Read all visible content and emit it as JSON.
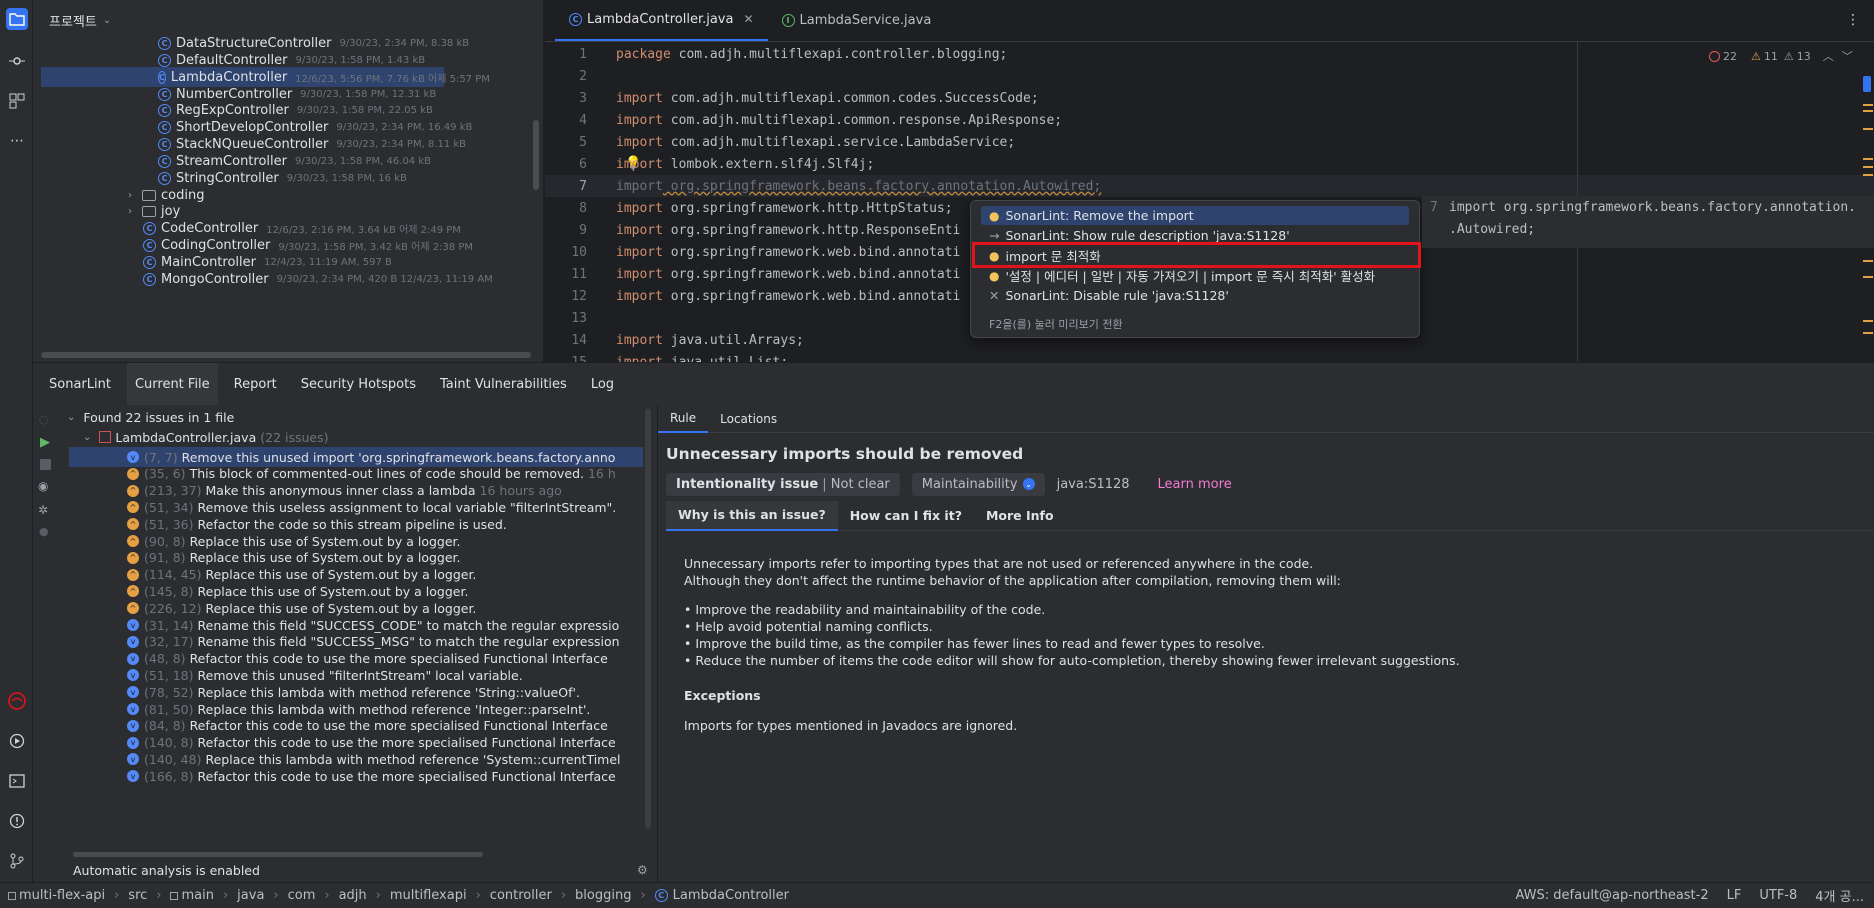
{
  "project": {
    "title": "프로젝트",
    "items": [
      {
        "name": "DataStructureController",
        "meta": "9/30/23, 2:34 PM, 8.38 kB",
        "type": "class"
      },
      {
        "name": "DefaultController",
        "meta": "9/30/23, 1:58 PM, 1.43 kB",
        "type": "class"
      },
      {
        "name": "LambdaController",
        "meta": "12/6/23, 5:56 PM, 7.76 kB 어제 5:57 PM",
        "type": "class",
        "selected": true
      },
      {
        "name": "NumberController",
        "meta": "9/30/23, 1:58 PM, 12.31 kB",
        "type": "class"
      },
      {
        "name": "RegExpController",
        "meta": "9/30/23, 1:58 PM, 22.05 kB",
        "type": "class"
      },
      {
        "name": "ShortDevelopController",
        "meta": "9/30/23, 2:34 PM, 16.49 kB",
        "type": "class"
      },
      {
        "name": "StackNQueueController",
        "meta": "9/30/23, 2:34 PM, 8.11 kB",
        "type": "class"
      },
      {
        "name": "StreamController",
        "meta": "9/30/23, 1:58 PM, 46.04 kB",
        "type": "class"
      },
      {
        "name": "StringController",
        "meta": "9/30/23, 1:58 PM, 16 kB",
        "type": "class"
      },
      {
        "name": "coding",
        "meta": "",
        "type": "folder"
      },
      {
        "name": "joy",
        "meta": "",
        "type": "folder"
      },
      {
        "name": "CodeController",
        "meta": "12/6/23, 2:16 PM, 3.64 kB 어제 2:49 PM",
        "type": "class"
      },
      {
        "name": "CodingController",
        "meta": "9/30/23, 1:58 PM, 3.42 kB 어제 2:38 PM",
        "type": "class"
      },
      {
        "name": "MainController",
        "meta": "12/4/23, 11:19 AM, 597 B",
        "type": "class"
      },
      {
        "name": "MongoController",
        "meta": "9/30/23, 2:34 PM, 420 B 12/4/23, 11:19 AM",
        "type": "class"
      }
    ]
  },
  "editor": {
    "tabs": [
      {
        "label": "LambdaController.java",
        "active": true
      },
      {
        "label": "LambdaService.java",
        "active": false
      }
    ],
    "inspections": {
      "errors": "22",
      "warnings": "11",
      "weak": "13"
    },
    "lines": [
      {
        "n": "1",
        "kw": "package",
        "rest": " com.adjh.multiflexapi.controller.blogging;"
      },
      {
        "n": "2",
        "kw": "",
        "rest": ""
      },
      {
        "n": "3",
        "kw": "import",
        "rest": " com.adjh.multiflexapi.common.codes.SuccessCode;"
      },
      {
        "n": "4",
        "kw": "import",
        "rest": " com.adjh.multiflexapi.common.response.ApiResponse;"
      },
      {
        "n": "5",
        "kw": "import",
        "rest": " com.adjh.multiflexapi.service.LambdaService;"
      },
      {
        "n": "6",
        "kw": "import",
        "rest": " lombok.extern.slf4j.Slf4j;"
      },
      {
        "n": "7",
        "kw": "import",
        "rest": " org.springframework.beans.factory.annotation.Autowired;"
      },
      {
        "n": "8",
        "kw": "import",
        "rest": " org.springframework.http.HttpStatus;"
      },
      {
        "n": "9",
        "kw": "import",
        "rest": " org.springframework.http.ResponseEnti"
      },
      {
        "n": "10",
        "kw": "import",
        "rest": " org.springframework.web.bind.annotati"
      },
      {
        "n": "11",
        "kw": "import",
        "rest": " org.springframework.web.bind.annotati"
      },
      {
        "n": "12",
        "kw": "import",
        "rest": " org.springframework.web.bind.annotati"
      },
      {
        "n": "13",
        "kw": "",
        "rest": ""
      },
      {
        "n": "14",
        "kw": "import",
        "rest": " java.util.Arrays;"
      },
      {
        "n": "15",
        "kw": "import",
        "rest": " java.util.List;"
      }
    ]
  },
  "popup": {
    "items": [
      {
        "label": "SonarLint: Remove the import",
        "icon": "bulb",
        "selected": true
      },
      {
        "label": "SonarLint: Show rule description 'java:S1128'",
        "icon": "arrow"
      },
      {
        "label": "import 문 최적화",
        "icon": "bulb"
      },
      {
        "label": "'설정 | 에디터 | 일반 | 자동 가져오기 | import 문 즉시 최적화' 활성화",
        "icon": "bulb"
      },
      {
        "label": "SonarLint: Disable rule 'java:S1128'",
        "icon": "x"
      }
    ],
    "footer": "F2을(를) 눌러 미리보기 전환",
    "preview_line_num": "7",
    "preview_line1": "import org.springframework.beans.factory.annotation.",
    "preview_line2": ".Autowired;"
  },
  "bottom": {
    "tabs": [
      "SonarLint",
      "Current File",
      "Report",
      "Security Hotspots",
      "Taint Vulnerabilities",
      "Log"
    ],
    "found": "Found 22 issues in 1 file",
    "file": "LambdaController.java",
    "file_count": "(22 issues)",
    "issues": [
      {
        "loc": "(7, 7)",
        "msg": "Remove this unused import 'org.springframework.beans.factory.anno",
        "sev": "minor",
        "selected": true
      },
      {
        "loc": "(35, 6)",
        "msg": "This block of commented-out lines of code should be removed.",
        "extra": "16 h",
        "sev": "major"
      },
      {
        "loc": "(213, 37)",
        "msg": "Make this anonymous inner class a lambda",
        "extra": "16 hours ago",
        "sev": "major"
      },
      {
        "loc": "(51, 34)",
        "msg": "Remove this useless assignment to local variable \"filterIntStream\".",
        "sev": "major"
      },
      {
        "loc": "(51, 36)",
        "msg": "Refactor the code so this stream pipeline is used.",
        "sev": "major"
      },
      {
        "loc": "(90, 8)",
        "msg": "Replace this use of System.out by a logger.",
        "sev": "major"
      },
      {
        "loc": "(91, 8)",
        "msg": "Replace this use of System.out by a logger.",
        "sev": "major"
      },
      {
        "loc": "(114, 45)",
        "msg": "Replace this use of System.out by a logger.",
        "sev": "major"
      },
      {
        "loc": "(145, 8)",
        "msg": "Replace this use of System.out by a logger.",
        "sev": "major"
      },
      {
        "loc": "(226, 12)",
        "msg": "Replace this use of System.out by a logger.",
        "sev": "major"
      },
      {
        "loc": "(31, 14)",
        "msg": "Rename this field \"SUCCESS_CODE\" to match the regular expressio",
        "sev": "minor"
      },
      {
        "loc": "(32, 17)",
        "msg": "Rename this field \"SUCCESS_MSG\" to match the regular expression",
        "sev": "minor"
      },
      {
        "loc": "(48, 8)",
        "msg": "Refactor this code to use the more specialised Functional Interface",
        "sev": "minor"
      },
      {
        "loc": "(51, 18)",
        "msg": "Remove this unused \"filterIntStream\" local variable.",
        "sev": "minor"
      },
      {
        "loc": "(78, 52)",
        "msg": "Replace this lambda with method reference 'String::valueOf'.",
        "sev": "minor"
      },
      {
        "loc": "(81, 50)",
        "msg": "Replace this lambda with method reference 'Integer::parseInt'.",
        "sev": "minor"
      },
      {
        "loc": "(84, 8)",
        "msg": "Refactor this code to use the more specialised Functional Interface",
        "sev": "minor"
      },
      {
        "loc": "(140, 8)",
        "msg": "Refactor this code to use the more specialised Functional Interface",
        "sev": "minor"
      },
      {
        "loc": "(140, 48)",
        "msg": "Replace this lambda with method reference 'System::currentTimel",
        "sev": "minor"
      },
      {
        "loc": "(166, 8)",
        "msg": "Refactor this code to use the more specialised Functional Interface",
        "sev": "minor"
      }
    ],
    "auto_analysis": "Automatic analysis is enabled",
    "rule": {
      "tabs": [
        "Rule",
        "Locations"
      ],
      "title": "Unnecessary imports should be removed",
      "intentionality": "Intentionality issue",
      "clarity": "Not clear",
      "quality": "Maintainability",
      "key": "java:S1128",
      "learn_more": "Learn more",
      "subtabs": [
        "Why is this an issue?",
        "How can I fix it?",
        "More Info"
      ],
      "para1": "Unnecessary imports refer to importing types that are not used or referenced anywhere in the code.",
      "para2": "Although they don't affect the runtime behavior of the application after compilation, removing them will:",
      "bullets": [
        "Improve the readability and maintainability of the code.",
        "Help avoid potential naming conflicts.",
        "Improve the build time, as the compiler has fewer lines to read and fewer types to resolve.",
        "Reduce the number of items the code editor will show for auto-completion, thereby showing fewer irrelevant suggestions."
      ],
      "exceptions_title": "Exceptions",
      "exceptions_text": "Imports for types mentioned in Javadocs are ignored."
    }
  },
  "status": {
    "breadcrumb": [
      "multi-flex-api",
      "src",
      "main",
      "java",
      "com",
      "adjh",
      "multiflexapi",
      "controller",
      "blogging",
      "LambdaController"
    ],
    "aws": "AWS: default@ap-northeast-2",
    "line_sep": "LF",
    "encoding": "UTF-8",
    "indent": "4개 공..."
  },
  "colors": {
    "accent": "#3574f0",
    "highlight": "#e1141a",
    "keyword": "#cf8e6d",
    "learn_more": "#f47bd4"
  }
}
